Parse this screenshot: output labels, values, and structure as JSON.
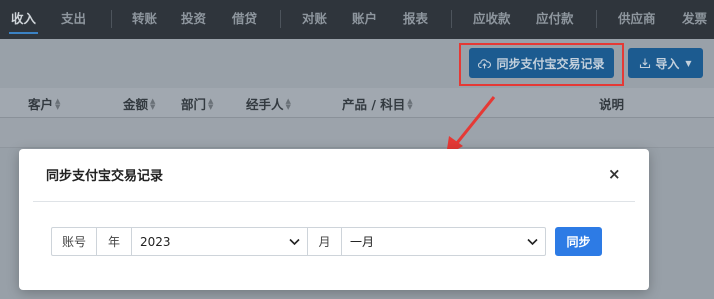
{
  "nav": {
    "items": [
      "收入",
      "支出",
      "转账",
      "投资",
      "借贷",
      "对账",
      "账户",
      "报表",
      "应收款",
      "应付款",
      "供应商",
      "发票"
    ],
    "active": "收入"
  },
  "toolbar": {
    "sync_button": "同步支付宝交易记录",
    "sync_icon": "cloud-upload-icon",
    "import_button": "导入",
    "import_icon": "download-icon"
  },
  "table": {
    "headers": [
      "客户",
      "金额",
      "部门",
      "经手人",
      "产品 / 科目",
      "说明"
    ]
  },
  "modal": {
    "title": "同步支付宝交易记录",
    "close": "×",
    "account_label": "账号",
    "year_label": "年",
    "year_value": "2023",
    "month_label": "月",
    "month_value": "一月",
    "submit": "同步"
  },
  "colors": {
    "nav_bg": "#2f353c",
    "button_blue": "#2d7be5",
    "highlight_red": "#e53935"
  }
}
